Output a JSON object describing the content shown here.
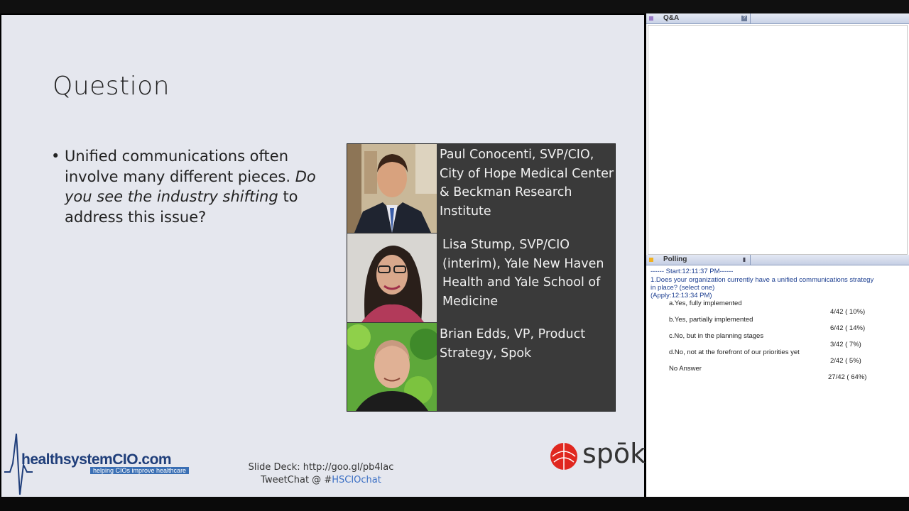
{
  "slide": {
    "title": "Question",
    "bullet_plain": "Unified communications often involve many different pieces.",
    "bullet_italic": "Do you see the industry shifting",
    "bullet_tail": "to address this issue?",
    "speakers": [
      {
        "name_lines": [
          "Paul Conocenti, SVP/CIO,",
          "City of Hope Medical Center",
          "& Beckman Research",
          "Institute"
        ]
      },
      {
        "name_lines": [
          "Lisa Stump,  SVP/CIO",
          "(interim), Yale New Haven",
          "Health and Yale School of",
          "Medicine"
        ]
      },
      {
        "name_lines": [
          "Brian Edds, VP, Product",
          "Strategy, Spok"
        ]
      }
    ],
    "logo_main_a": "healthsystem",
    "logo_main_b": "CIO.com",
    "logo_tagline": "helping CIOs improve healthcare",
    "footer_slide_deck": "Slide Deck: http://goo.gl/pb4lac",
    "footer_tweetchat_prefix": "TweetChat @ #",
    "footer_tweetchat_tag": "HSCIOchat",
    "brand_logo": "spōk"
  },
  "qa_panel": {
    "title": "Q&A"
  },
  "polling_panel": {
    "title": "Polling",
    "start_line": "------ Start:12:11:37 PM------",
    "question_line1": "1.Does your organization currently have a unified communications strategy",
    "question_line2": "in place? (select one)",
    "apply_line": "(Apply:12:13:34 PM)",
    "options": [
      {
        "label": "a.Yes, fully implemented",
        "result": "4/42 (  10%)"
      },
      {
        "label": "b.Yes, partially implemented",
        "result": "6/42 (  14%)"
      },
      {
        "label": "c.No, but in the planning stages",
        "result": "3/42 (   7%)"
      },
      {
        "label": "d.No, not at the forefront of our priorities yet",
        "result": "2/42 (   5%)"
      },
      {
        "label": "No Answer",
        "result": "27/42 (  64%)"
      }
    ]
  },
  "colors": {
    "slide_bg": "#e5e7ee",
    "panel_bg": "#3a3a3a",
    "link_blue": "#3b6fc4",
    "poll_blue": "#1d3f91",
    "spok_red": "#e0271f"
  }
}
